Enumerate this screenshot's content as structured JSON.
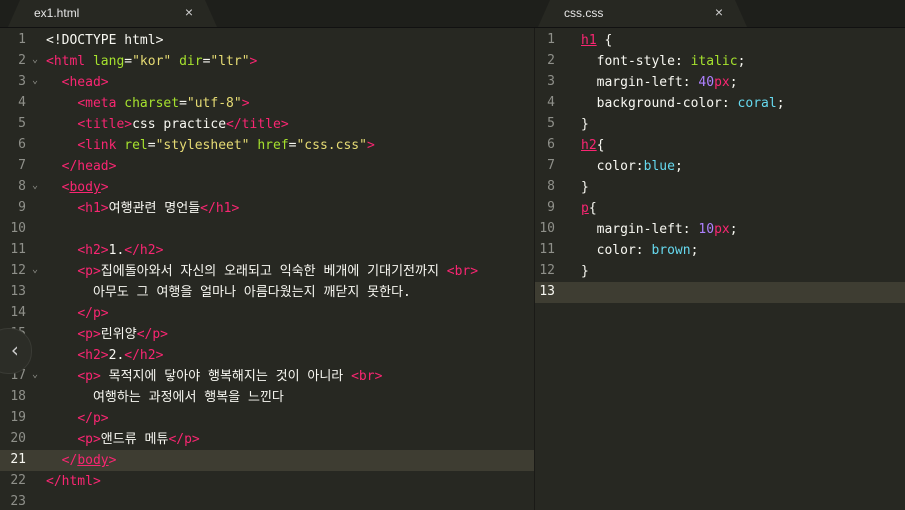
{
  "tabs": [
    {
      "label": "ex1.html",
      "close": "×"
    },
    {
      "label": "css.css",
      "close": "×"
    }
  ],
  "nav_icon": "‹",
  "html_editor": {
    "line_numbers": [
      "1",
      "2",
      "3",
      "4",
      "5",
      "6",
      "7",
      "8",
      "9",
      "10",
      "11",
      "12",
      "13",
      "14",
      "15",
      "16",
      "17",
      "18",
      "19",
      "20",
      "21",
      "22",
      "23"
    ],
    "current_line": "21",
    "fold_markers": [
      "2",
      "3",
      "8",
      "12",
      "17"
    ],
    "code": {
      "l1": "<!DOCTYPE html>",
      "l2_open": "<html",
      "l2_attr1": "lang",
      "l2_val1": "\"kor\"",
      "l2_attr2": "dir",
      "l2_val2": "\"ltr\"",
      "l3": "<head>",
      "l4_tag": "<meta",
      "l4_attr": "charset",
      "l4_val": "\"utf-8\"",
      "l5_open": "<title>",
      "l5_text": "css practice",
      "l5_close": "</title>",
      "l6_tag": "<link",
      "l6_attr1": "rel",
      "l6_val1": "\"stylesheet\"",
      "l6_attr2": "href",
      "l6_val2": "\"css.css\"",
      "l7": "</head>",
      "l8_bracket_open": "<",
      "l8_tag": "body",
      "l8_bracket_close": ">",
      "l9_open": "<h1>",
      "l9_text": "여행관련 명언들",
      "l9_close": "</h1>",
      "l11_open": "<h2>",
      "l11_text": "1.",
      "l11_close": "</h2>",
      "l12_open": "<p>",
      "l12_text": "집에돌아와서 자신의 오래되고 익숙한 베개에 기대기전까지",
      "l12_br": "<br>",
      "l13_text": "아무도 그 여행을 얼마나 아름다웠는지 깨닫지 못한다.",
      "l14": "</p>",
      "l15_open": "<p>",
      "l15_text": "린위양",
      "l15_close": "</p>",
      "l16_open": "<h2>",
      "l16_text": "2.",
      "l16_close": "</h2>",
      "l17_open": "<p>",
      "l17_text": " 목적지에 닿아야 행복해지는 것이 아니라",
      "l17_br": "<br>",
      "l18_text": "여행하는 과정에서 행복을 느낀다",
      "l19": "</p>",
      "l20_open": "<p>",
      "l20_text": "앤드류 메튜",
      "l20_close": "</p>",
      "l21_open": "</",
      "l21_tag": "body",
      "l21_close": ">",
      "l22": "</html>"
    }
  },
  "css_editor": {
    "line_numbers": [
      "1",
      "2",
      "3",
      "4",
      "5",
      "6",
      "7",
      "8",
      "9",
      "10",
      "11",
      "12",
      "13"
    ],
    "current_line": "13",
    "code": {
      "l1_sel": "h1",
      "l1_brace": " {",
      "l2_prop": "font-style",
      "l2_val": "italic",
      "l3_prop": "margin-left",
      "l3_num": "40",
      "l3_unit": "px",
      "l4_prop": "background-color",
      "l4_val": "coral",
      "l5": "}",
      "l6_sel": "h2",
      "l6_brace": "{",
      "l7_prop": "color",
      "l7_val": "blue",
      "l8": "}",
      "l9_sel": "p",
      "l9_brace": "{",
      "l10_prop": "margin-left",
      "l10_num": "10",
      "l10_unit": "px",
      "l11_prop": "color",
      "l11_val": "brown",
      "l12": "}"
    }
  },
  "colors": {
    "background": "#272822",
    "tag": "#f92672",
    "attribute": "#a6e22e",
    "string": "#e6db74",
    "property": "#66d9ef",
    "number": "#ae81ff"
  }
}
